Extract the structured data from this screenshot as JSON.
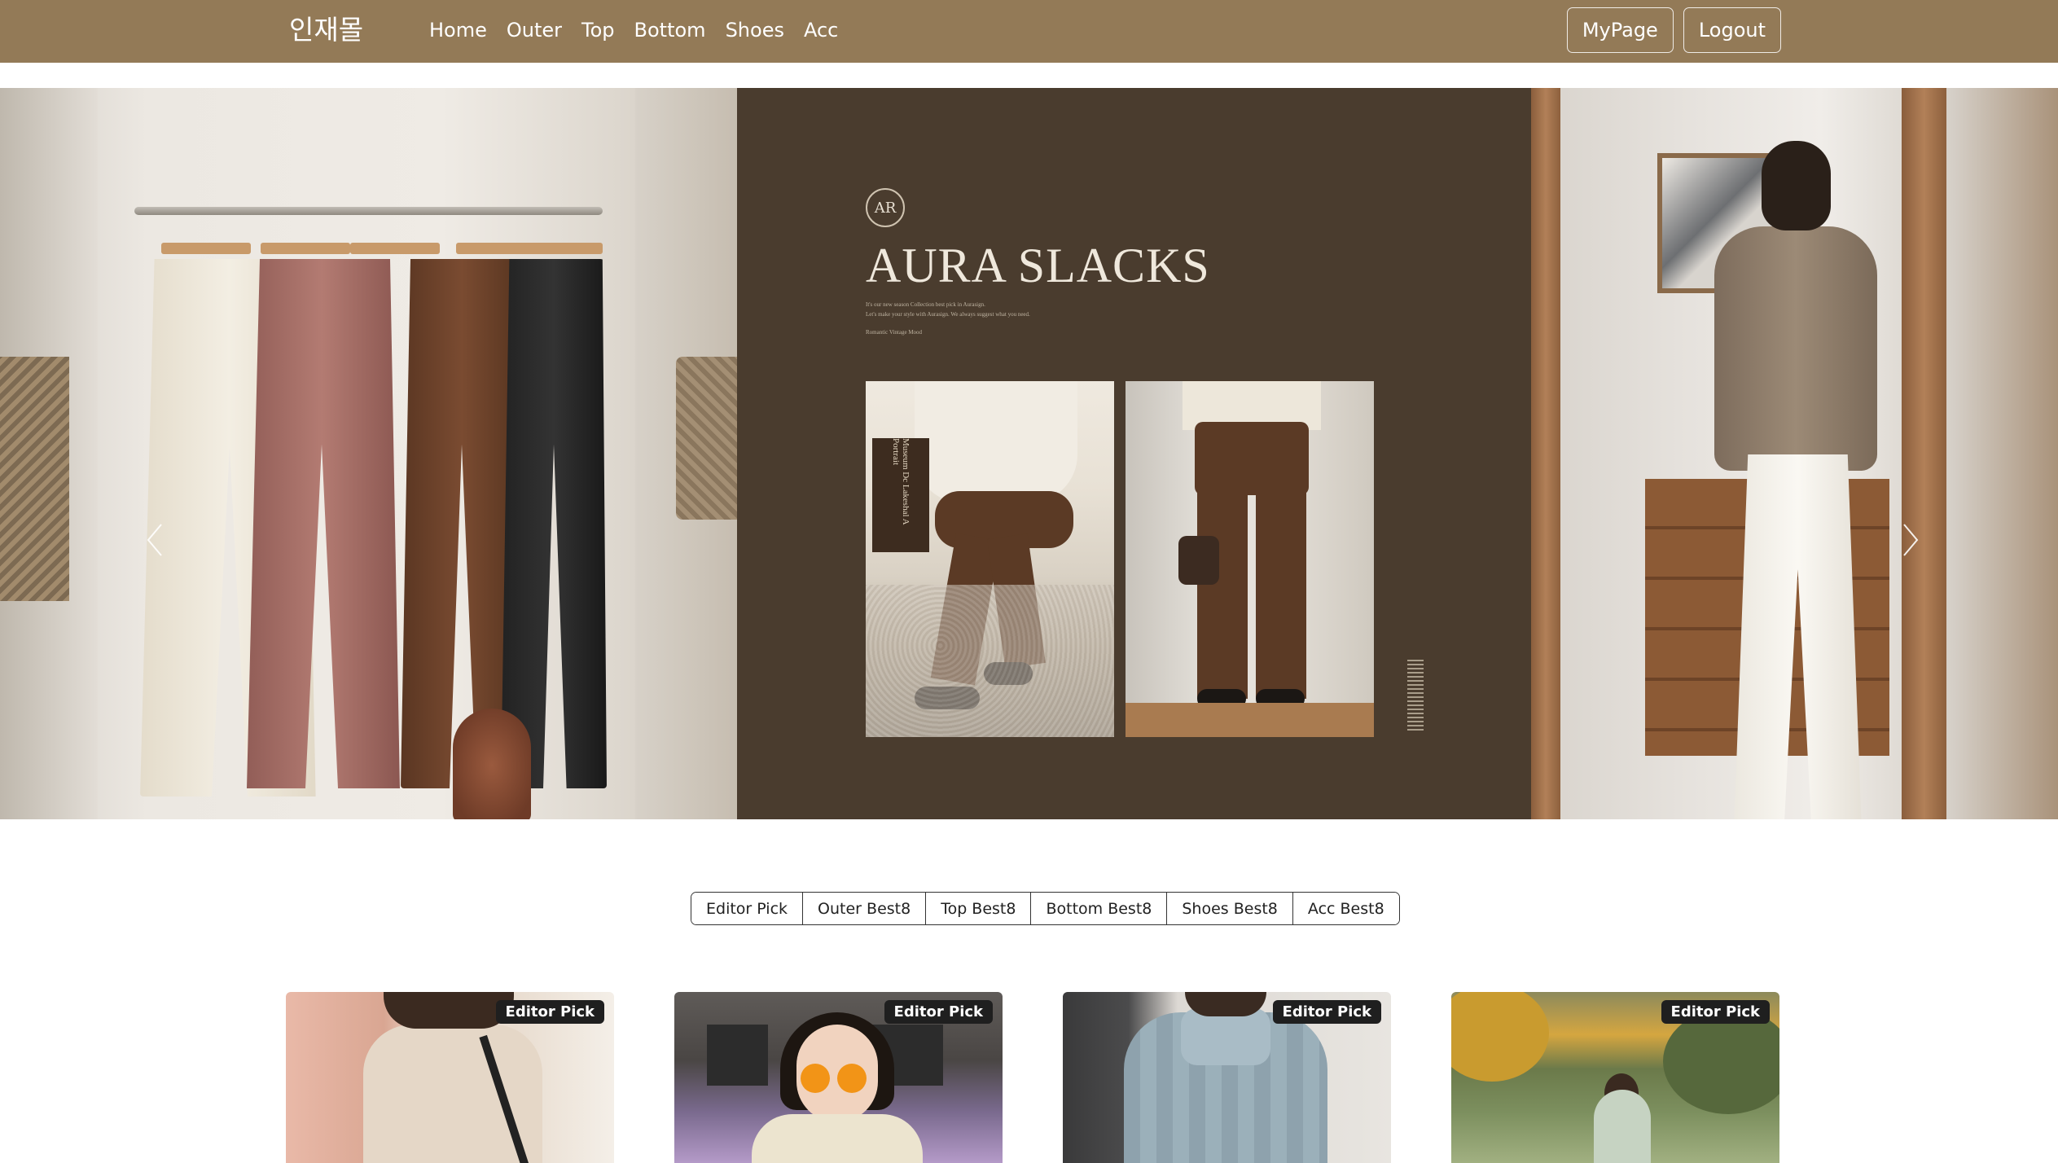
{
  "nav": {
    "brand": "인재몰",
    "links": [
      "Home",
      "Outer",
      "Top",
      "Bottom",
      "Shoes",
      "Acc"
    ],
    "mypage": "MyPage",
    "logout": "Logout",
    "bg_color": "#937a57"
  },
  "carousel": {
    "prev_icon": "chevron-left-icon",
    "next_icon": "chevron-right-icon",
    "middle_slide": {
      "logo": "AR",
      "title": "AURA SLACKS",
      "sub_lines": [
        "It's our new season Collection best pick in Aurasign.",
        "Let's make your style with Aurasign. We always suggest what you need.",
        "Romantic Vintage Mood"
      ],
      "book_text": "Museum Dc Lakeshal A Portrait"
    }
  },
  "tabs": [
    "Editor Pick",
    "Outer Best8",
    "Top Best8",
    "Bottom Best8",
    "Shoes Best8",
    "Acc Best8"
  ],
  "cards": [
    {
      "badge": "Editor Pick"
    },
    {
      "badge": "Editor Pick"
    },
    {
      "badge": "Editor Pick"
    },
    {
      "badge": "Editor Pick"
    }
  ]
}
